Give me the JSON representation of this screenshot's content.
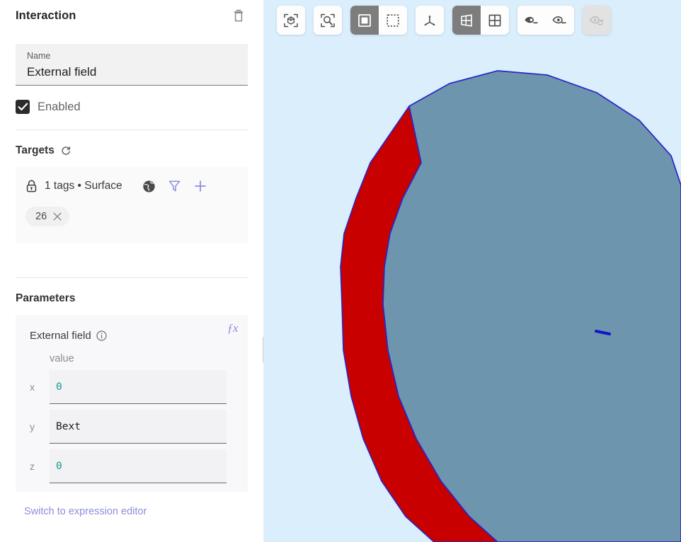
{
  "panel": {
    "title": "Interaction",
    "delete_icon": "trash-icon",
    "name_label": "Name",
    "name_value": "External field",
    "enabled_label": "Enabled",
    "enabled_checked": true
  },
  "targets": {
    "title": "Targets",
    "refresh_icon": "refresh-icon",
    "lock_icon": "lock-icon",
    "summary": "1 tags • Surface",
    "actions": [
      {
        "name": "globe-icon",
        "label": "globe"
      },
      {
        "name": "filter-icon",
        "label": "filter"
      },
      {
        "name": "add-icon",
        "label": "add"
      }
    ],
    "chips": [
      {
        "label": "26",
        "remove_icon": "close-icon"
      }
    ]
  },
  "parameters": {
    "title": "Parameters",
    "fx_label": "ƒx",
    "param_name": "External field",
    "info_icon": "info-icon",
    "value_header": "value",
    "fields": [
      {
        "key": "x",
        "value": "0",
        "type": "number"
      },
      {
        "key": "y",
        "value": "Bext",
        "type": "text"
      },
      {
        "key": "z",
        "value": "0",
        "type": "number"
      }
    ],
    "switch_link": "Switch to expression editor"
  },
  "toolbar": {
    "groups": [
      {
        "name": "frame-group",
        "buttons": [
          {
            "name": "frame-all-icon",
            "icon": "frame-cube",
            "active": false,
            "disabled": false
          }
        ]
      },
      {
        "name": "zoom-group",
        "buttons": [
          {
            "name": "zoom-to-selection-icon",
            "icon": "frame-magnifier",
            "active": false,
            "disabled": false
          }
        ]
      },
      {
        "name": "selection-mode-group",
        "buttons": [
          {
            "name": "solid-select-icon",
            "icon": "square-solid",
            "active": true,
            "disabled": false
          },
          {
            "name": "box-select-icon",
            "icon": "square-dashed",
            "active": false,
            "disabled": false
          }
        ]
      },
      {
        "name": "axes-group",
        "buttons": [
          {
            "name": "axes-gizmo-icon",
            "icon": "axes",
            "active": false,
            "disabled": false
          }
        ]
      },
      {
        "name": "projection-group",
        "buttons": [
          {
            "name": "perspective-view-icon",
            "icon": "perspective",
            "active": true,
            "disabled": false
          },
          {
            "name": "orthographic-view-icon",
            "icon": "grid",
            "active": false,
            "disabled": false
          }
        ]
      },
      {
        "name": "visibility-group",
        "buttons": [
          {
            "name": "show-all-icon",
            "icon": "eye-filled",
            "active": false,
            "disabled": false
          },
          {
            "name": "hide-icon",
            "icon": "eye-outline",
            "active": false,
            "disabled": false
          }
        ]
      },
      {
        "name": "reset-visibility-group",
        "buttons": [
          {
            "name": "reset-visibility-icon",
            "icon": "eye-refresh",
            "active": false,
            "disabled": true
          }
        ]
      }
    ]
  },
  "viewport": {
    "name": "3d-viewport",
    "background_color": "#daeefc",
    "mesh_fill_color": "#6d95ad",
    "mesh_edge_color": "#2727c8",
    "highlight_color": "#c80000",
    "vector_marker_color": "#1414c8"
  },
  "colors": {
    "accent_purple": "#8d8ddc",
    "value_teal": "#0f9b8e",
    "toolbar_active": "#7d7d7d"
  }
}
